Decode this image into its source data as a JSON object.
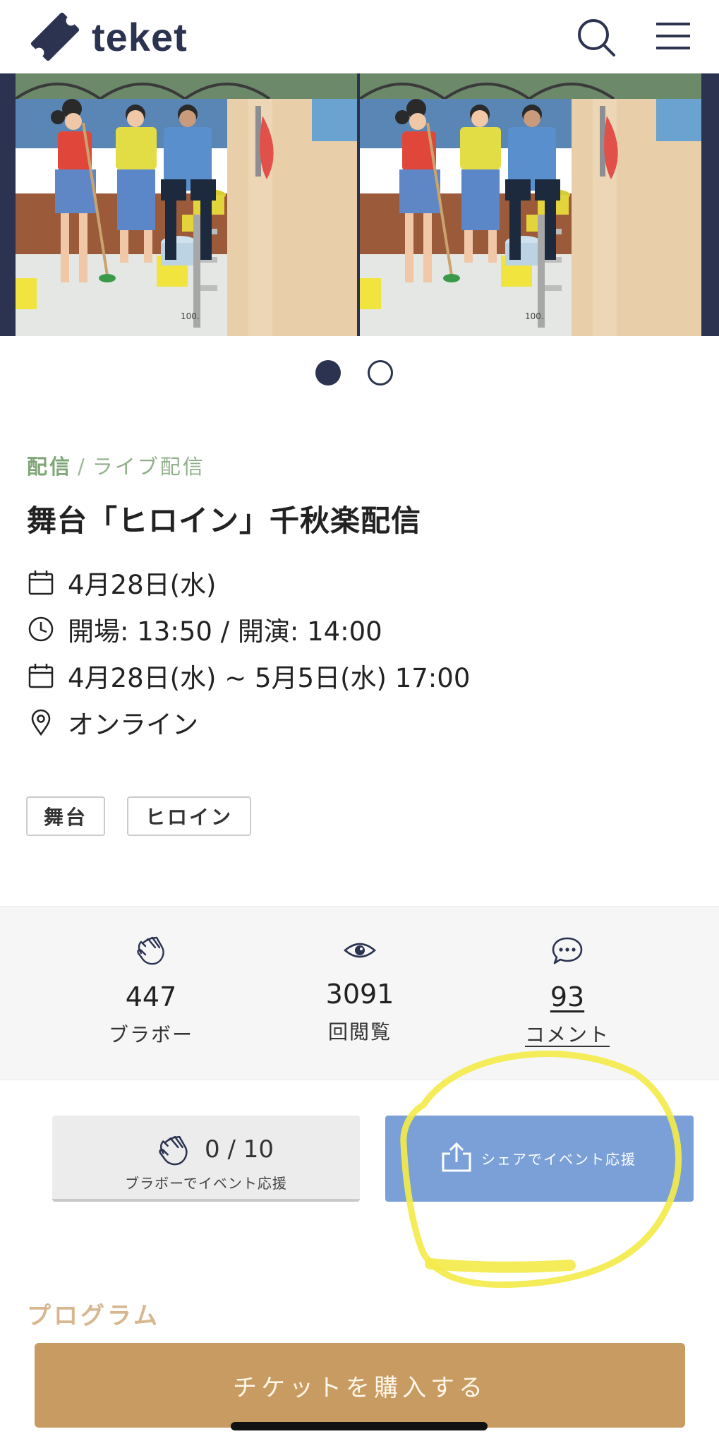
{
  "header": {
    "logo_text": "teket",
    "search_icon": "search-icon",
    "menu_icon": "hamburger-menu-icon"
  },
  "hero": {
    "slides": [
      "poster-image",
      "poster-image"
    ],
    "poster_caption": "100.",
    "active_slide": 1,
    "slide_count": 2
  },
  "event": {
    "breadcrumb": [
      "配信",
      "ライブ配信"
    ],
    "breadcrumb_separator": "/",
    "title": "舞台「ヒロイン」千秋楽配信",
    "date": "4月28日(水)",
    "time": "開場: 13:50 / 開演: 14:00",
    "period": "4月28日(水) ~ 5月5日(水) 17:00",
    "venue": "オンライン",
    "tags": [
      "舞台",
      "ヒロイン"
    ]
  },
  "stats": {
    "bravo": {
      "icon": "clap-icon",
      "value": "447",
      "label": "ブラボー"
    },
    "views": {
      "icon": "eye-icon",
      "value": "3091",
      "label": "回閲覧"
    },
    "comments": {
      "icon": "comment-bubble-icon",
      "value": "93",
      "label": "コメント"
    }
  },
  "actions": {
    "bravo_count": "0 / 10",
    "bravo_label": "ブラボーでイベント応援",
    "share_label": "シェアでイベント応援"
  },
  "program": {
    "title": "プログラム"
  },
  "ticket": {
    "button_label": "チケットを購入する"
  },
  "colors": {
    "brand_navy": "#2c3350",
    "breadcrumb_green": "#7fa676",
    "share_blue": "#7ba0d8",
    "ticket_gold": "#c89b62",
    "program_gold": "#d7b690",
    "highlight_yellow": "#f3ea4a"
  }
}
